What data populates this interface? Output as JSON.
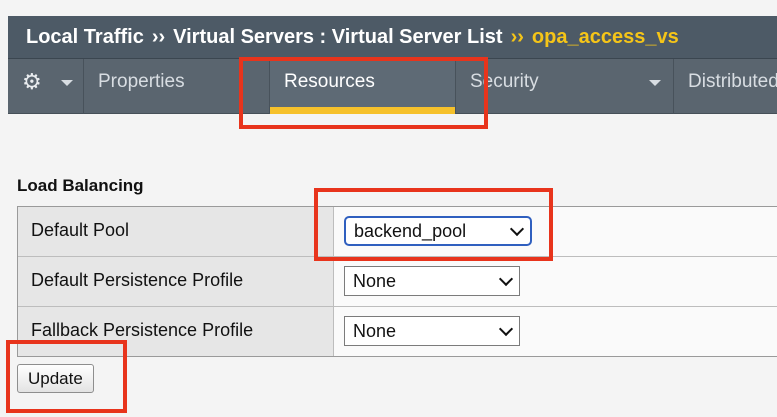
{
  "breadcrumb": {
    "part1": "Local Traffic",
    "sep1": "››",
    "part2": "Virtual Servers : Virtual Server List",
    "sep2": "››",
    "current": "opa_access_vs"
  },
  "tabs": [
    {
      "label": "Properties",
      "active": false
    },
    {
      "label": "Resources",
      "active": true
    },
    {
      "label": "Security",
      "active": false,
      "has_dropdown": true
    },
    {
      "label": "Distributed",
      "active": false
    }
  ],
  "gear_menu": {
    "icon": "gear-icon"
  },
  "section": {
    "title": "Load Balancing"
  },
  "fields": [
    {
      "label": "Default Pool",
      "value": "backend_pool"
    },
    {
      "label": "Default Persistence Profile",
      "value": "None"
    },
    {
      "label": "Fallback Persistence Profile",
      "value": "None"
    }
  ],
  "update_button": {
    "label": "Update"
  },
  "colors": {
    "header_bg": "#4d5a66",
    "tabbar_bg": "#5a656f",
    "accent_yellow": "#f6c12b",
    "breadcrumb_current": "#f5c518",
    "annotation_red": "#e8341c",
    "focus_blue": "#2f5fbf"
  }
}
